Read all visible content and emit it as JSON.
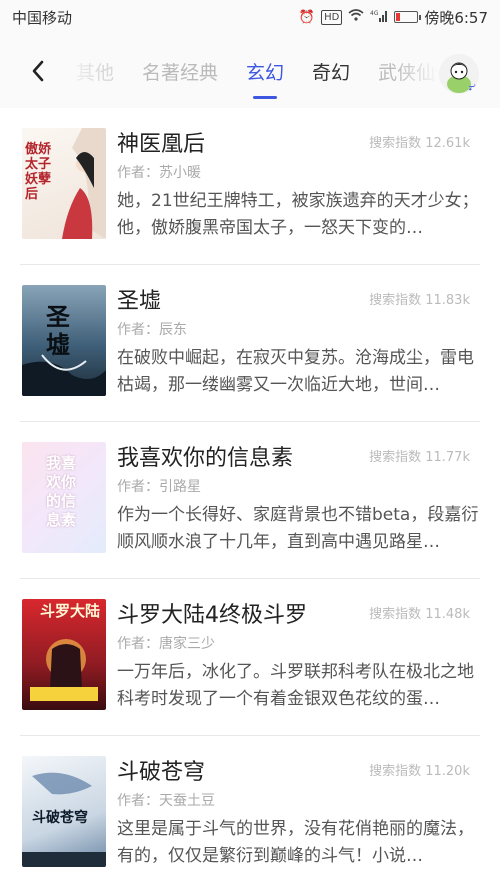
{
  "status": {
    "carrier": "中国移动",
    "time": "傍晚6:57",
    "hd": "HD",
    "signal": "4G"
  },
  "nav": {
    "tabs": [
      {
        "label": "其他",
        "state": "fade"
      },
      {
        "label": "名著经典",
        "state": "normal"
      },
      {
        "label": "玄幻",
        "state": "active"
      },
      {
        "label": "奇幻",
        "state": "dark"
      },
      {
        "label": "武侠仙侠",
        "state": "normal"
      }
    ]
  },
  "books": [
    {
      "title": "神医凰后",
      "index_label": "搜索指数 12.61k",
      "author_label": "作者：苏小暖",
      "description": "她，21世纪王牌特工，被家族遗弃的天才少女；他，傲娇腹黑帝国太子，一怒天下变的…",
      "cover_text": "傲娇太子妖孽后",
      "cover_color": "#f6f2ee"
    },
    {
      "title": "圣墟",
      "index_label": "搜索指数 11.83k",
      "author_label": "作者：辰东",
      "description": "在破败中崛起，在寂灭中复苏。沧海成尘，雷电枯竭，那一缕幽雾又一次临近大地，世间…",
      "cover_text": "圣墟",
      "cover_color": "#3f5f78"
    },
    {
      "title": "我喜欢你的信息素",
      "index_label": "搜索指数 11.77k",
      "author_label": "作者：引路星",
      "description": "作为一个长得好、家庭背景也不错beta，段嘉衍顺风顺水浪了十几年，直到高中遇见路星…",
      "cover_text": "我喜欢你的信息素",
      "cover_color": "#f9e6ee"
    },
    {
      "title": "斗罗大陆4终极斗罗",
      "index_label": "搜索指数 11.48k",
      "author_label": "作者：唐家三少",
      "description": "一万年后，冰化了。斗罗联邦科考队在极北之地科考时发现了一个有着金银双色花纹的蛋…",
      "cover_text": "斗罗大陆",
      "cover_color": "#a7232a"
    },
    {
      "title": "斗破苍穹",
      "index_label": "搜索指数 11.20k",
      "author_label": "作者：天蚕土豆",
      "description": "这里是属于斗气的世界，没有花俏艳丽的魔法，有的，仅仅是繁衍到巅峰的斗气！小说…",
      "cover_text": "斗破苍穹",
      "cover_color": "#dfe7ef"
    }
  ],
  "colors": {
    "accent": "#3d57e0"
  }
}
